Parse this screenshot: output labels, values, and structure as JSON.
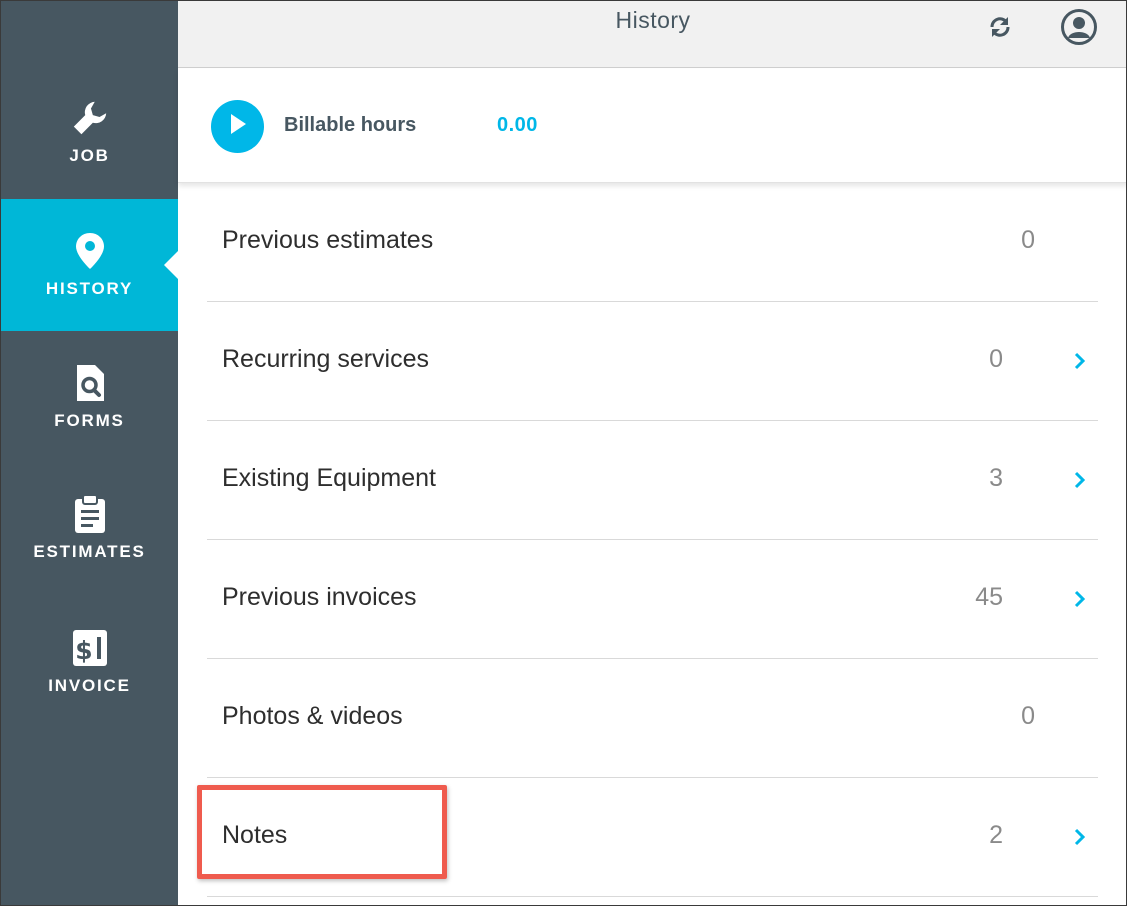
{
  "header": {
    "title": "History"
  },
  "sidebar": {
    "items": [
      {
        "label": "JOB",
        "icon": "wrench-icon",
        "active": false
      },
      {
        "label": "HISTORY",
        "icon": "location-pin-icon",
        "active": true
      },
      {
        "label": "FORMS",
        "icon": "document-search-icon",
        "active": false
      },
      {
        "label": "ESTIMATES",
        "icon": "clipboard-icon",
        "active": false
      },
      {
        "label": "INVOICE",
        "icon": "invoice-dollar-icon",
        "active": false
      }
    ]
  },
  "billable": {
    "label": "Billable hours",
    "value": "0.00"
  },
  "history_rows": [
    {
      "label": "Previous estimates",
      "count": "0",
      "has_chevron": false
    },
    {
      "label": "Recurring services",
      "count": "0",
      "has_chevron": true
    },
    {
      "label": "Existing Equipment",
      "count": "3",
      "has_chevron": true
    },
    {
      "label": "Previous invoices",
      "count": "45",
      "has_chevron": true
    },
    {
      "label": "Photos & videos",
      "count": "0",
      "has_chevron": false
    },
    {
      "label": "Notes",
      "count": "2",
      "has_chevron": true
    }
  ],
  "colors": {
    "accent": "#00b7d7",
    "sidebar": "#475761",
    "highlight": "#ef5b4e"
  }
}
